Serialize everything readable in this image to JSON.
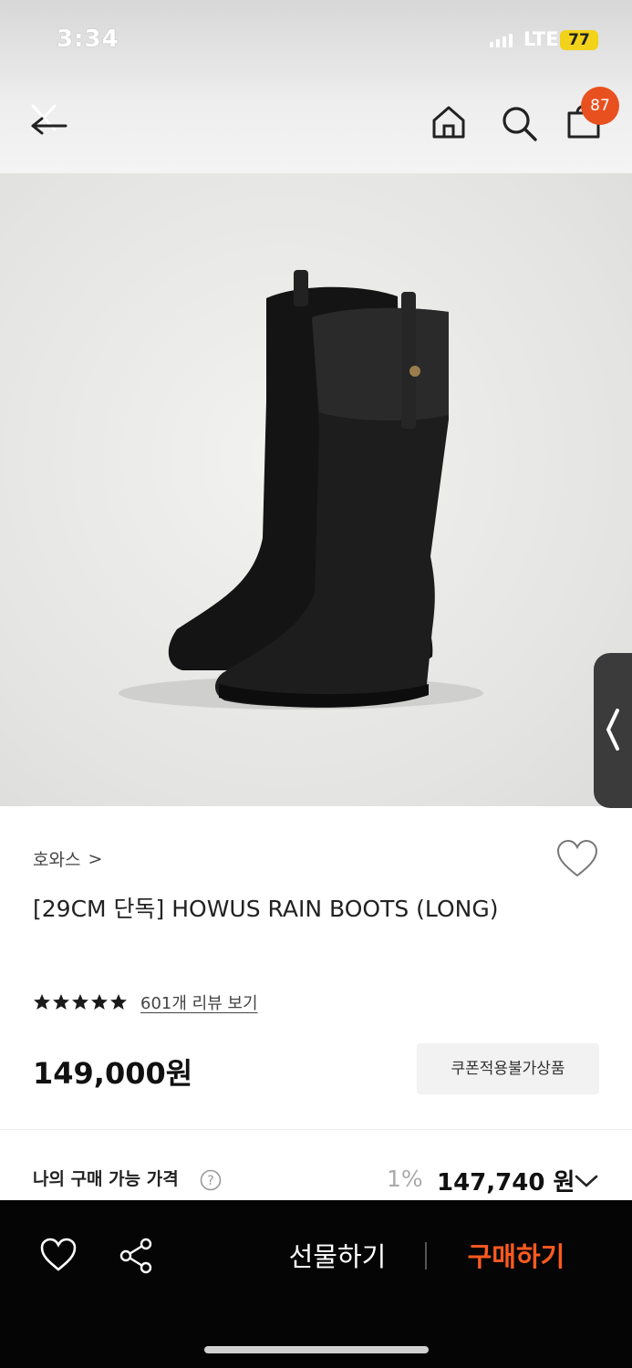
{
  "status_bar": {
    "time": "3:34",
    "network": "LTE",
    "battery": "77"
  },
  "header": {
    "cart_count": "87"
  },
  "product": {
    "brand": "호와스",
    "brand_chevron": ">",
    "title": "[29CM 단독] HOWUS RAIN BOOTS (LONG)",
    "rating": 5,
    "review_link": "601개 리뷰 보기",
    "price": "149,000원",
    "coupon_badge": "쿠폰적용불가상품"
  },
  "my_price": {
    "label": "나의 구매 가능 가격",
    "discount_rate": "1%",
    "price": "147,740 원"
  },
  "bottom_bar": {
    "gift_label": "선물하기",
    "buy_label": "구매하기"
  },
  "colors": {
    "accent": "#ff5a1f",
    "badge": "#e9501f",
    "bar": "#050505"
  },
  "icons": [
    "back-arrow-icon",
    "close-icon",
    "home-icon",
    "search-icon",
    "shopping-bag-icon",
    "heart-icon",
    "share-icon",
    "chevron-left-icon",
    "chevron-down-icon",
    "question-icon",
    "star-icon"
  ]
}
